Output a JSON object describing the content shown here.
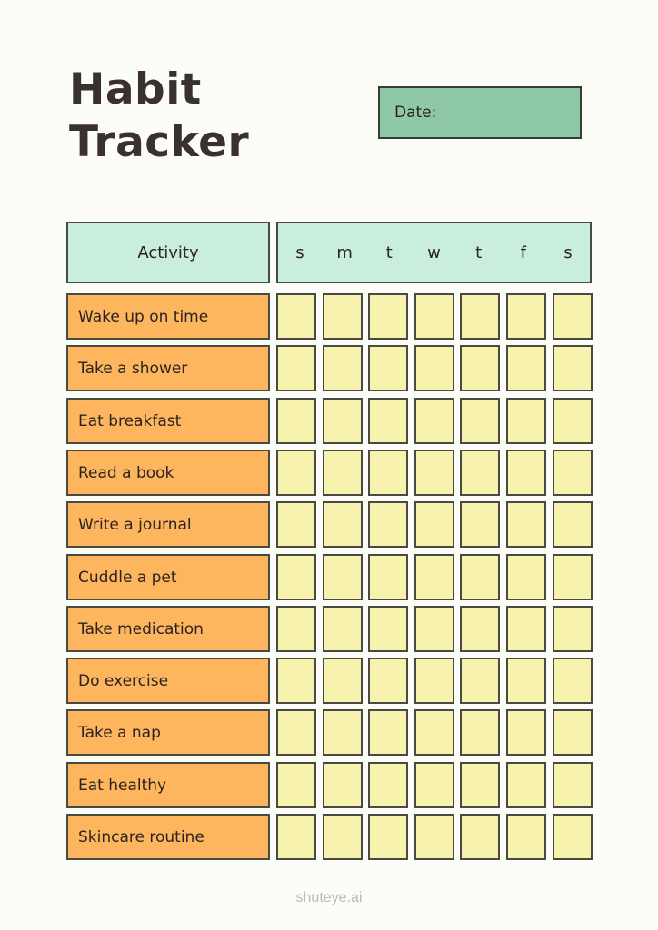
{
  "title": {
    "line1": "Habit",
    "line2": "Tracker"
  },
  "date_field": {
    "label": "Date:",
    "value": ""
  },
  "table": {
    "activity_header": "Activity",
    "days": [
      "s",
      "m",
      "t",
      "w",
      "t",
      "f",
      "s"
    ],
    "activities": [
      "Wake up on time",
      "Take a shower",
      "Eat breakfast",
      "Read a book",
      "Write a journal",
      "Cuddle a pet",
      "Take medication",
      "Do exercise",
      "Take a nap",
      "Eat healthy",
      "Skincare routine"
    ],
    "checked": [
      [
        false,
        false,
        false,
        false,
        false,
        false,
        false
      ],
      [
        false,
        false,
        false,
        false,
        false,
        false,
        false
      ],
      [
        false,
        false,
        false,
        false,
        false,
        false,
        false
      ],
      [
        false,
        false,
        false,
        false,
        false,
        false,
        false
      ],
      [
        false,
        false,
        false,
        false,
        false,
        false,
        false
      ],
      [
        false,
        false,
        false,
        false,
        false,
        false,
        false
      ],
      [
        false,
        false,
        false,
        false,
        false,
        false,
        false
      ],
      [
        false,
        false,
        false,
        false,
        false,
        false,
        false
      ],
      [
        false,
        false,
        false,
        false,
        false,
        false,
        false
      ],
      [
        false,
        false,
        false,
        false,
        false,
        false,
        false
      ],
      [
        false,
        false,
        false,
        false,
        false,
        false,
        false
      ]
    ]
  },
  "colors": {
    "background": "#fdfdf8",
    "date_box": "#8fc8a6",
    "header": "#c9eedc",
    "activity_cell": "#fdb55e",
    "check_cell": "#f7f3ae",
    "border": "#4a4a45"
  },
  "footer": {
    "watermark": "shuteye.ai"
  }
}
